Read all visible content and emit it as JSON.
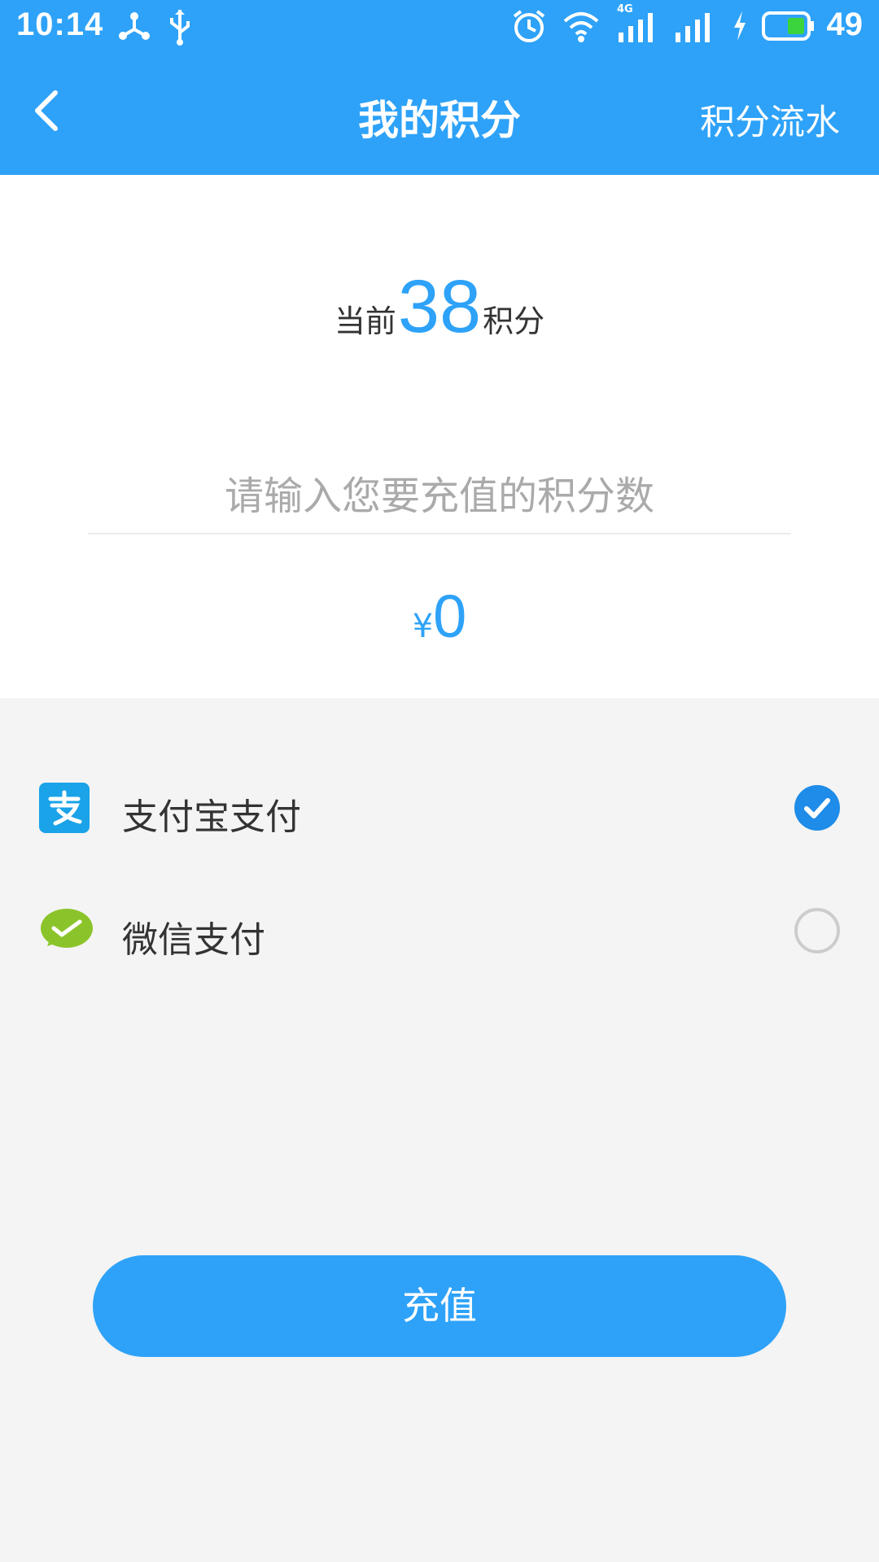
{
  "status_bar": {
    "time": "10:14",
    "battery_level": "49",
    "network_label": "4G"
  },
  "header": {
    "title": "我的积分",
    "history_link": "积分流水"
  },
  "points": {
    "prefix": "当前",
    "value": "38",
    "suffix": "积分"
  },
  "recharge_input": {
    "placeholder": "请输入您要充值的积分数",
    "value": ""
  },
  "price": {
    "symbol": "¥",
    "value": "0"
  },
  "payment_methods": [
    {
      "label": "支付宝支付",
      "icon": "alipay-icon",
      "selected": true
    },
    {
      "label": "微信支付",
      "icon": "wechat-pay-icon",
      "selected": false
    }
  ],
  "recharge_button": {
    "label": "充值"
  },
  "colors": {
    "accent": "#2ea2f8",
    "alipay": "#1aa3e8",
    "wechat": "#8bc42a",
    "background": "#f4f4f4"
  }
}
